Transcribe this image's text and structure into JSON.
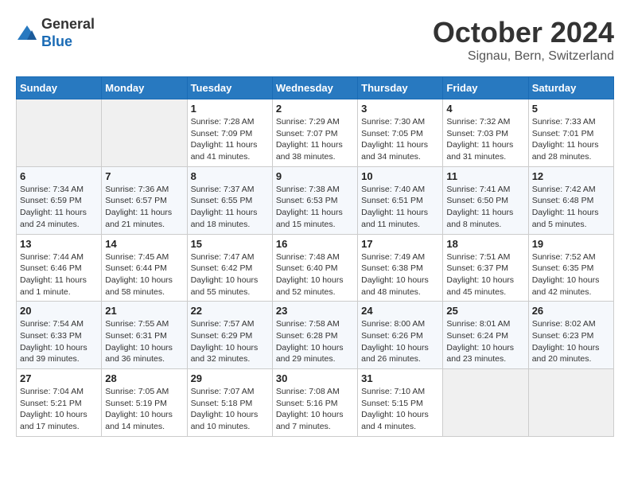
{
  "header": {
    "logo_line1": "General",
    "logo_line2": "Blue",
    "month": "October 2024",
    "location": "Signau, Bern, Switzerland"
  },
  "weekdays": [
    "Sunday",
    "Monday",
    "Tuesday",
    "Wednesday",
    "Thursday",
    "Friday",
    "Saturday"
  ],
  "weeks": [
    [
      {
        "day": "",
        "sunrise": "",
        "sunset": "",
        "daylight": "",
        "empty": true
      },
      {
        "day": "",
        "sunrise": "",
        "sunset": "",
        "daylight": "",
        "empty": true
      },
      {
        "day": "1",
        "sunrise": "Sunrise: 7:28 AM",
        "sunset": "Sunset: 7:09 PM",
        "daylight": "Daylight: 11 hours and 41 minutes."
      },
      {
        "day": "2",
        "sunrise": "Sunrise: 7:29 AM",
        "sunset": "Sunset: 7:07 PM",
        "daylight": "Daylight: 11 hours and 38 minutes."
      },
      {
        "day": "3",
        "sunrise": "Sunrise: 7:30 AM",
        "sunset": "Sunset: 7:05 PM",
        "daylight": "Daylight: 11 hours and 34 minutes."
      },
      {
        "day": "4",
        "sunrise": "Sunrise: 7:32 AM",
        "sunset": "Sunset: 7:03 PM",
        "daylight": "Daylight: 11 hours and 31 minutes."
      },
      {
        "day": "5",
        "sunrise": "Sunrise: 7:33 AM",
        "sunset": "Sunset: 7:01 PM",
        "daylight": "Daylight: 11 hours and 28 minutes."
      }
    ],
    [
      {
        "day": "6",
        "sunrise": "Sunrise: 7:34 AM",
        "sunset": "Sunset: 6:59 PM",
        "daylight": "Daylight: 11 hours and 24 minutes."
      },
      {
        "day": "7",
        "sunrise": "Sunrise: 7:36 AM",
        "sunset": "Sunset: 6:57 PM",
        "daylight": "Daylight: 11 hours and 21 minutes."
      },
      {
        "day": "8",
        "sunrise": "Sunrise: 7:37 AM",
        "sunset": "Sunset: 6:55 PM",
        "daylight": "Daylight: 11 hours and 18 minutes."
      },
      {
        "day": "9",
        "sunrise": "Sunrise: 7:38 AM",
        "sunset": "Sunset: 6:53 PM",
        "daylight": "Daylight: 11 hours and 15 minutes."
      },
      {
        "day": "10",
        "sunrise": "Sunrise: 7:40 AM",
        "sunset": "Sunset: 6:51 PM",
        "daylight": "Daylight: 11 hours and 11 minutes."
      },
      {
        "day": "11",
        "sunrise": "Sunrise: 7:41 AM",
        "sunset": "Sunset: 6:50 PM",
        "daylight": "Daylight: 11 hours and 8 minutes."
      },
      {
        "day": "12",
        "sunrise": "Sunrise: 7:42 AM",
        "sunset": "Sunset: 6:48 PM",
        "daylight": "Daylight: 11 hours and 5 minutes."
      }
    ],
    [
      {
        "day": "13",
        "sunrise": "Sunrise: 7:44 AM",
        "sunset": "Sunset: 6:46 PM",
        "daylight": "Daylight: 11 hours and 1 minute."
      },
      {
        "day": "14",
        "sunrise": "Sunrise: 7:45 AM",
        "sunset": "Sunset: 6:44 PM",
        "daylight": "Daylight: 10 hours and 58 minutes."
      },
      {
        "day": "15",
        "sunrise": "Sunrise: 7:47 AM",
        "sunset": "Sunset: 6:42 PM",
        "daylight": "Daylight: 10 hours and 55 minutes."
      },
      {
        "day": "16",
        "sunrise": "Sunrise: 7:48 AM",
        "sunset": "Sunset: 6:40 PM",
        "daylight": "Daylight: 10 hours and 52 minutes."
      },
      {
        "day": "17",
        "sunrise": "Sunrise: 7:49 AM",
        "sunset": "Sunset: 6:38 PM",
        "daylight": "Daylight: 10 hours and 48 minutes."
      },
      {
        "day": "18",
        "sunrise": "Sunrise: 7:51 AM",
        "sunset": "Sunset: 6:37 PM",
        "daylight": "Daylight: 10 hours and 45 minutes."
      },
      {
        "day": "19",
        "sunrise": "Sunrise: 7:52 AM",
        "sunset": "Sunset: 6:35 PM",
        "daylight": "Daylight: 10 hours and 42 minutes."
      }
    ],
    [
      {
        "day": "20",
        "sunrise": "Sunrise: 7:54 AM",
        "sunset": "Sunset: 6:33 PM",
        "daylight": "Daylight: 10 hours and 39 minutes."
      },
      {
        "day": "21",
        "sunrise": "Sunrise: 7:55 AM",
        "sunset": "Sunset: 6:31 PM",
        "daylight": "Daylight: 10 hours and 36 minutes."
      },
      {
        "day": "22",
        "sunrise": "Sunrise: 7:57 AM",
        "sunset": "Sunset: 6:29 PM",
        "daylight": "Daylight: 10 hours and 32 minutes."
      },
      {
        "day": "23",
        "sunrise": "Sunrise: 7:58 AM",
        "sunset": "Sunset: 6:28 PM",
        "daylight": "Daylight: 10 hours and 29 minutes."
      },
      {
        "day": "24",
        "sunrise": "Sunrise: 8:00 AM",
        "sunset": "Sunset: 6:26 PM",
        "daylight": "Daylight: 10 hours and 26 minutes."
      },
      {
        "day": "25",
        "sunrise": "Sunrise: 8:01 AM",
        "sunset": "Sunset: 6:24 PM",
        "daylight": "Daylight: 10 hours and 23 minutes."
      },
      {
        "day": "26",
        "sunrise": "Sunrise: 8:02 AM",
        "sunset": "Sunset: 6:23 PM",
        "daylight": "Daylight: 10 hours and 20 minutes."
      }
    ],
    [
      {
        "day": "27",
        "sunrise": "Sunrise: 7:04 AM",
        "sunset": "Sunset: 5:21 PM",
        "daylight": "Daylight: 10 hours and 17 minutes."
      },
      {
        "day": "28",
        "sunrise": "Sunrise: 7:05 AM",
        "sunset": "Sunset: 5:19 PM",
        "daylight": "Daylight: 10 hours and 14 minutes."
      },
      {
        "day": "29",
        "sunrise": "Sunrise: 7:07 AM",
        "sunset": "Sunset: 5:18 PM",
        "daylight": "Daylight: 10 hours and 10 minutes."
      },
      {
        "day": "30",
        "sunrise": "Sunrise: 7:08 AM",
        "sunset": "Sunset: 5:16 PM",
        "daylight": "Daylight: 10 hours and 7 minutes."
      },
      {
        "day": "31",
        "sunrise": "Sunrise: 7:10 AM",
        "sunset": "Sunset: 5:15 PM",
        "daylight": "Daylight: 10 hours and 4 minutes."
      },
      {
        "day": "",
        "sunrise": "",
        "sunset": "",
        "daylight": "",
        "empty": true
      },
      {
        "day": "",
        "sunrise": "",
        "sunset": "",
        "daylight": "",
        "empty": true
      }
    ]
  ]
}
